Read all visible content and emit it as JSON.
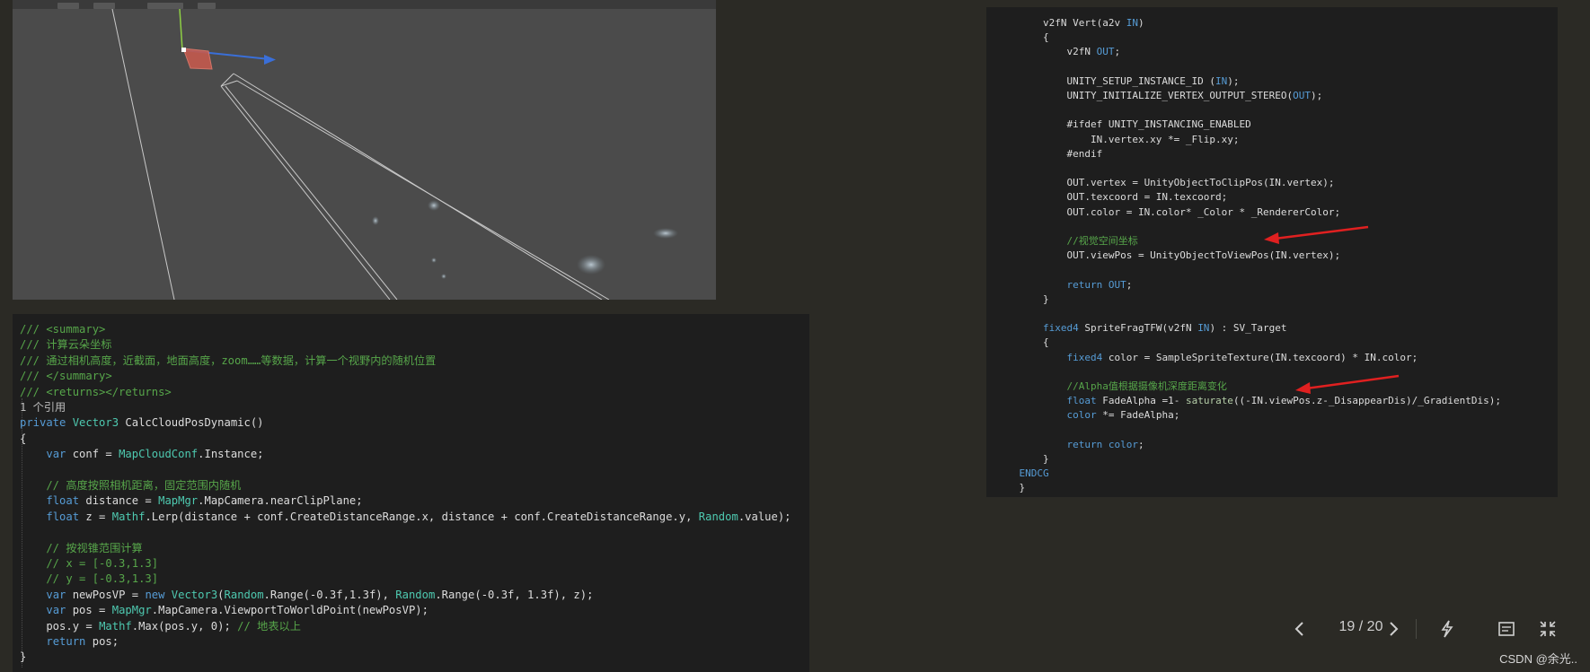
{
  "csharp_code": {
    "lines": [
      [
        [
          "/// <summary>",
          "com"
        ]
      ],
      [
        [
          "/// 计算云朵坐标",
          "com"
        ]
      ],
      [
        [
          "/// 通过相机高度，近截面，地面高度，zoom……等数据，计算一个视野内的随机位置",
          "com"
        ]
      ],
      [
        [
          "/// </summary>",
          "com"
        ]
      ],
      [
        [
          "/// <returns></returns>",
          "com"
        ]
      ],
      [
        [
          "1 个引用",
          "ref"
        ]
      ],
      [
        [
          "private ",
          "kw"
        ],
        [
          "Vector3",
          "type"
        ],
        [
          " CalcCloudPosDynamic()",
          "txt"
        ]
      ],
      [
        [
          "{",
          "txt"
        ]
      ],
      [
        [
          "    ",
          "txt"
        ],
        [
          "var",
          "kw"
        ],
        [
          " conf = ",
          "txt"
        ],
        [
          "MapCloudConf",
          "type"
        ],
        [
          ".Instance;",
          "txt"
        ]
      ],
      [],
      [
        [
          "    // 高度按照相机距离，固定范围内随机",
          "com"
        ]
      ],
      [
        [
          "    ",
          "txt"
        ],
        [
          "float",
          "kw"
        ],
        [
          " distance = ",
          "txt"
        ],
        [
          "MapMgr",
          "type"
        ],
        [
          ".MapCamera.nearClipPlane;",
          "txt"
        ]
      ],
      [
        [
          "    ",
          "txt"
        ],
        [
          "float",
          "kw"
        ],
        [
          " z = ",
          "txt"
        ],
        [
          "Mathf",
          "type"
        ],
        [
          ".Lerp(distance + conf.CreateDistanceRange.x, distance + conf.CreateDistanceRange.y, ",
          "txt"
        ],
        [
          "Random",
          "type"
        ],
        [
          ".value);",
          "txt"
        ]
      ],
      [],
      [
        [
          "    // 按视锥范围计算",
          "com"
        ]
      ],
      [
        [
          "    // x = [-0.3,1.3]",
          "com"
        ]
      ],
      [
        [
          "    // y = [-0.3,1.3]",
          "com"
        ]
      ],
      [
        [
          "    ",
          "txt"
        ],
        [
          "var",
          "kw"
        ],
        [
          " newPosVP = ",
          "txt"
        ],
        [
          "new ",
          "kw"
        ],
        [
          "Vector3",
          "type"
        ],
        [
          "(",
          "txt"
        ],
        [
          "Random",
          "type"
        ],
        [
          ".Range(-0.3f,1.3f), ",
          "txt"
        ],
        [
          "Random",
          "type"
        ],
        [
          ".Range(-0.3f, 1.3f), z);",
          "txt"
        ]
      ],
      [
        [
          "    ",
          "txt"
        ],
        [
          "var",
          "kw"
        ],
        [
          " pos = ",
          "txt"
        ],
        [
          "MapMgr",
          "type"
        ],
        [
          ".MapCamera.ViewportToWorldPoint(newPosVP);",
          "txt"
        ]
      ],
      [
        [
          "    pos.y = ",
          "txt"
        ],
        [
          "Mathf",
          "type"
        ],
        [
          ".Max(pos.y, 0); ",
          "txt"
        ],
        [
          "// 地表以上",
          "com"
        ]
      ],
      [
        [
          "    ",
          "txt"
        ],
        [
          "return",
          "kw"
        ],
        [
          " pos;",
          "txt"
        ]
      ],
      [
        [
          "}",
          "txt"
        ]
      ]
    ]
  },
  "shader_code": {
    "lines": [
      [
        [
          "        v2fN Vert(a2v ",
          "txt"
        ],
        [
          "IN",
          "kw"
        ],
        [
          ")",
          "txt"
        ]
      ],
      [
        [
          "        {",
          "txt"
        ]
      ],
      [
        [
          "            v2fN ",
          "txt"
        ],
        [
          "OUT",
          "kw"
        ],
        [
          ";",
          "txt"
        ]
      ],
      [],
      [
        [
          "            UNITY_SETUP_INSTANCE_ID (",
          "txt"
        ],
        [
          "IN",
          "kw"
        ],
        [
          ");",
          "txt"
        ]
      ],
      [
        [
          "            UNITY_INITIALIZE_VERTEX_OUTPUT_STEREO(",
          "txt"
        ],
        [
          "OUT",
          "kw"
        ],
        [
          ");",
          "txt"
        ]
      ],
      [],
      [
        [
          "            #ifdef UNITY_INSTANCING_ENABLED",
          "txt"
        ]
      ],
      [
        [
          "                IN.vertex.xy *= _Flip.xy;",
          "txt"
        ]
      ],
      [
        [
          "            #endif",
          "txt"
        ]
      ],
      [],
      [
        [
          "            OUT.vertex = UnityObjectToClipPos(IN.vertex);",
          "txt"
        ]
      ],
      [
        [
          "            OUT.texcoord = IN.texcoord;",
          "txt"
        ]
      ],
      [
        [
          "            OUT.color = IN.color* _Color * _RendererColor;",
          "txt"
        ]
      ],
      [],
      [
        [
          "            //视觉空间坐标",
          "com"
        ]
      ],
      [
        [
          "            OUT.viewPos = UnityObjectToViewPos(IN.vertex);",
          "txt"
        ]
      ],
      [],
      [
        [
          "            ",
          "txt"
        ],
        [
          "return",
          "kw"
        ],
        [
          " ",
          "txt"
        ],
        [
          "OUT",
          "kw"
        ],
        [
          ";",
          "txt"
        ]
      ],
      [
        [
          "        }",
          "txt"
        ]
      ],
      [],
      [
        [
          "        ",
          "txt"
        ],
        [
          "fixed4",
          "kw"
        ],
        [
          " SpriteFragTFW(v2fN ",
          "txt"
        ],
        [
          "IN",
          "kw"
        ],
        [
          ") : SV_Target",
          "txt"
        ]
      ],
      [
        [
          "        {",
          "txt"
        ]
      ],
      [
        [
          "            ",
          "txt"
        ],
        [
          "fixed4",
          "kw"
        ],
        [
          " color = SampleSpriteTexture(IN.texcoord) * IN.color;",
          "txt"
        ]
      ],
      [],
      [
        [
          "            //Alpha值根据摄像机深度距离变化",
          "com"
        ]
      ],
      [
        [
          "            ",
          "txt"
        ],
        [
          "float",
          "kw"
        ],
        [
          " FadeAlpha =1- ",
          "txt"
        ],
        [
          "saturate",
          "num"
        ],
        [
          "((-IN.viewPos.z-_DisappearDis)/_GradientDis);",
          "txt"
        ]
      ],
      [
        [
          "            ",
          "txt"
        ],
        [
          "color",
          "kw"
        ],
        [
          " *= FadeAlpha;",
          "txt"
        ]
      ],
      [],
      [
        [
          "            ",
          "txt"
        ],
        [
          "return",
          "kw"
        ],
        [
          " ",
          "txt"
        ],
        [
          "color",
          "kw"
        ],
        [
          ";",
          "txt"
        ]
      ],
      [
        [
          "        }",
          "txt"
        ]
      ],
      [
        [
          "    ENDCG",
          "kw"
        ]
      ],
      [
        [
          "    }",
          "txt"
        ]
      ]
    ]
  },
  "pager": {
    "current": "19",
    "total": "20",
    "text": "19 / 20"
  },
  "icons": {
    "prev": "chevron-left-icon",
    "next": "chevron-right-icon",
    "action1": "lightning-icon",
    "action2": "outline-icon",
    "action3": "collapse-icon"
  },
  "watermark": "CSDN @余光.."
}
